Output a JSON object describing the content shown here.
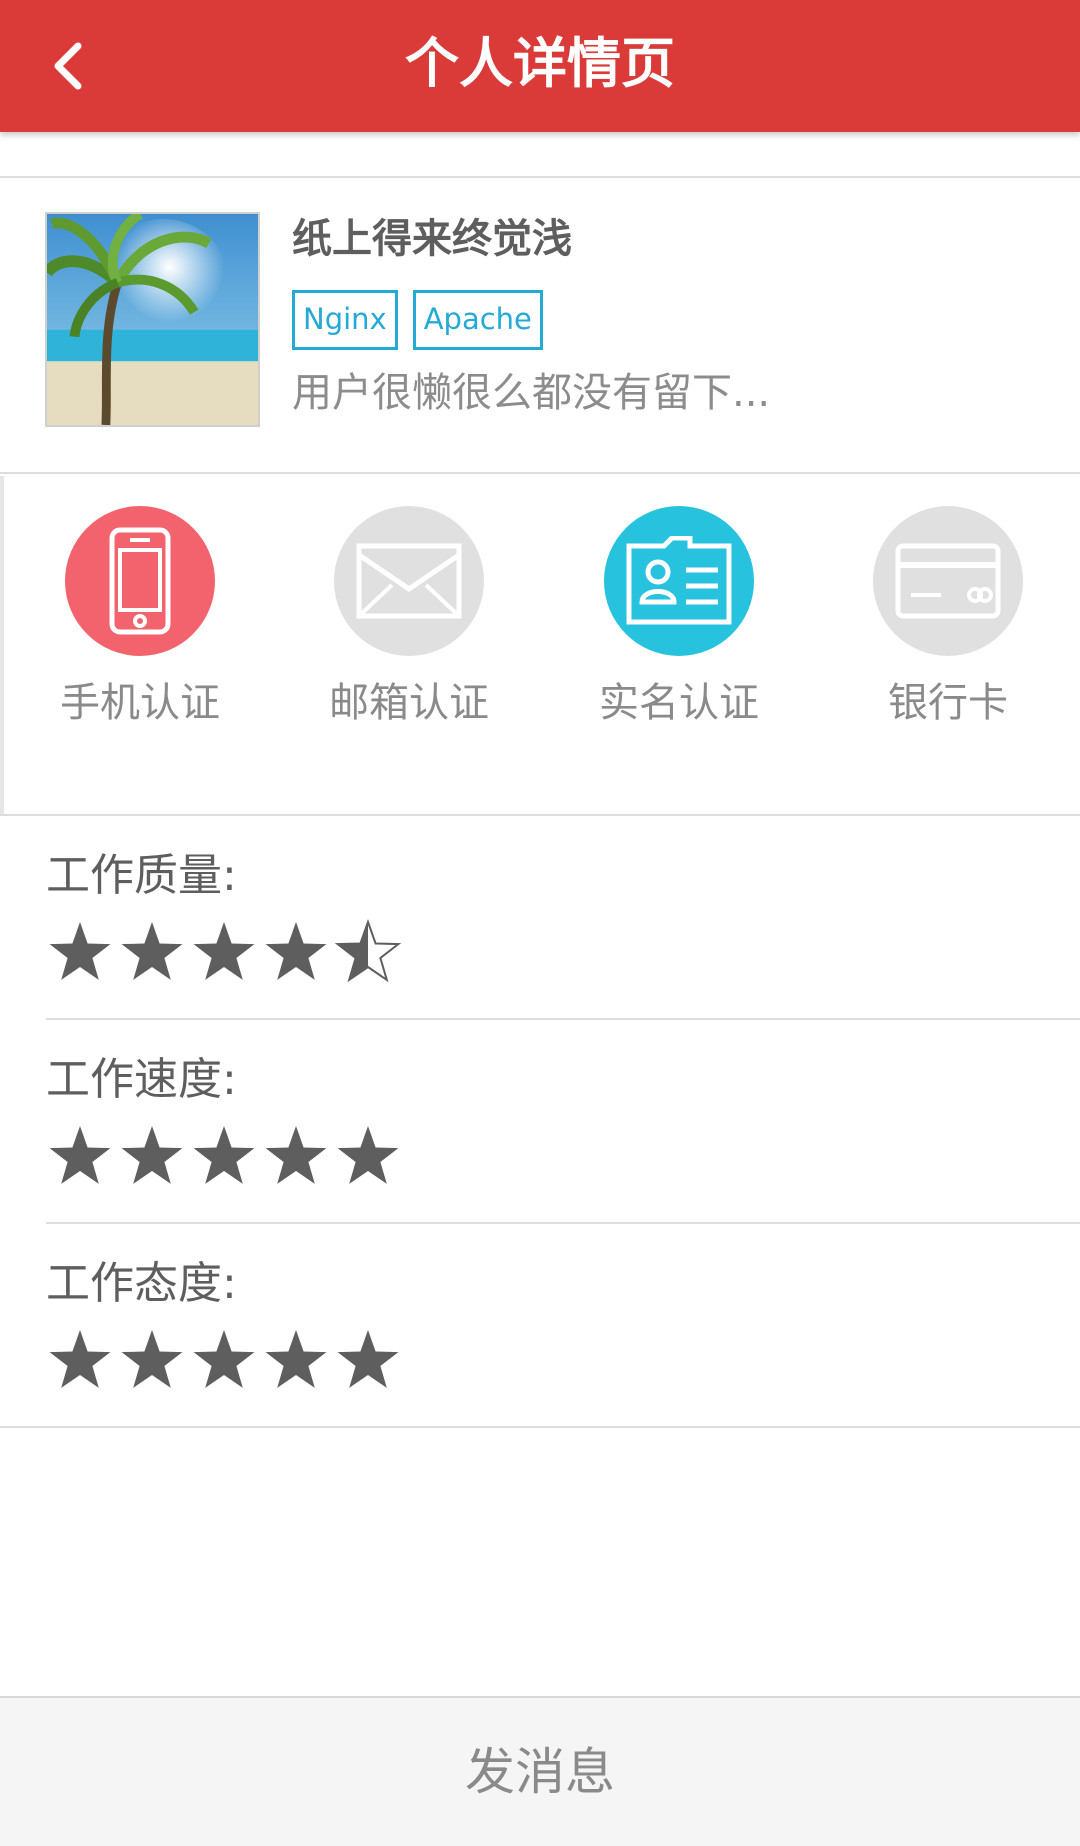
{
  "header": {
    "title": "个人详情页",
    "back_icon": "chevron-left-icon",
    "bg_color": "#da3b39"
  },
  "profile": {
    "name": "纸上得来终觉浅",
    "tags": [
      "Nginx",
      "Apache"
    ],
    "bio": "用户很懒很么都没有留下...",
    "avatar_icon": "palm-beach-photo"
  },
  "verifications": [
    {
      "label": "手机认证",
      "icon": "phone-icon",
      "color": "#f2636e",
      "verified": true
    },
    {
      "label": "邮箱认证",
      "icon": "envelope-icon",
      "color": "#e0e0e0",
      "verified": false
    },
    {
      "label": "实名认证",
      "icon": "id-card-icon",
      "color": "#26c2de",
      "verified": true
    },
    {
      "label": "银行卡",
      "icon": "bank-card-icon",
      "color": "#e0e0e0",
      "verified": false
    }
  ],
  "ratings": [
    {
      "label": "工作质量:",
      "stars": 4.5,
      "max": 5
    },
    {
      "label": "工作速度:",
      "stars": 5,
      "max": 5
    },
    {
      "label": "工作态度:",
      "stars": 5,
      "max": 5
    }
  ],
  "footer": {
    "send_label": "发消息"
  }
}
